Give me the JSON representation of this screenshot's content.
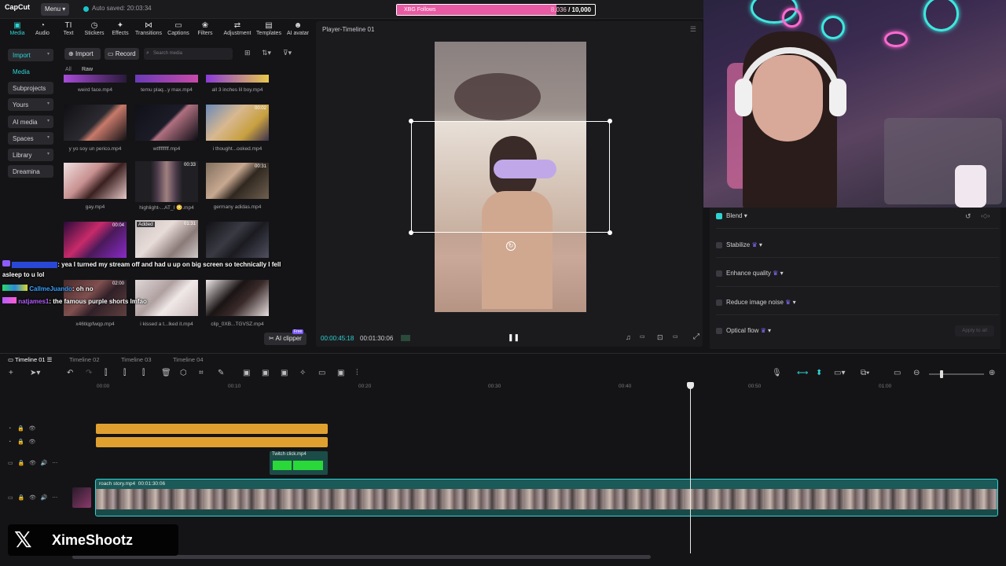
{
  "app": {
    "logo": "CapCut",
    "menu_label": "Menu",
    "autosave": "Auto saved: 20:03:34"
  },
  "follow_goal": {
    "label": "XBG Follows",
    "current": "8,036",
    "separator": " / ",
    "goal": "10,000",
    "progress": 0.8036
  },
  "tabs": [
    {
      "label": "Media",
      "icon": "media-icon",
      "active": true
    },
    {
      "label": "Audio",
      "icon": "audio-icon"
    },
    {
      "label": "Text",
      "icon": "text-icon"
    },
    {
      "label": "Stickers",
      "icon": "stickers-icon"
    },
    {
      "label": "Effects",
      "icon": "effects-icon"
    },
    {
      "label": "Transitions",
      "icon": "transitions-icon"
    },
    {
      "label": "Captions",
      "icon": "captions-icon"
    },
    {
      "label": "Filters",
      "icon": "filters-icon"
    },
    {
      "label": "Adjustment",
      "icon": "adjustment-icon"
    },
    {
      "label": "Templates",
      "icon": "templates-icon"
    },
    {
      "label": "AI avatar",
      "icon": "ai-avatar-icon"
    }
  ],
  "sidenav": [
    "Import",
    "Media",
    "Subprojects",
    "Yours",
    "AI media",
    "Spaces",
    "Library",
    "Dreamina"
  ],
  "media": {
    "import_label": "Import",
    "record_label": "Record",
    "search_placeholder": "Search media",
    "filter_all": "All",
    "filter_raw": "Raw",
    "items": [
      {
        "name": "weird face.mp4",
        "duration": ""
      },
      {
        "name": "temu plaq...y max.mp4",
        "duration": ""
      },
      {
        "name": "all 3 inches lil boy.mp4",
        "duration": ""
      },
      {
        "name": "y yo soy un perico.mp4",
        "duration": ""
      },
      {
        "name": "wtffffffff.mp4",
        "duration": ""
      },
      {
        "name": "i thought...ooked.mp4",
        "duration": "00:02"
      },
      {
        "name": "gay.mp4",
        "duration": ""
      },
      {
        "name": "highlight-...AT_I 😳.mp4",
        "duration": "00:33"
      },
      {
        "name": "germany adidas.mp4",
        "duration": "00:31"
      },
      {
        "name": "",
        "duration": "00:04"
      },
      {
        "name": "",
        "duration": "01:31",
        "badge": "Added"
      },
      {
        "name": "",
        "duration": ""
      },
      {
        "name": "x46tlqpfwqp.mp4",
        "duration": "02:00"
      },
      {
        "name": "i kissed a t...lked it.mp4",
        "duration": ""
      },
      {
        "name": "clip_0XB...TGVSZ.mp4",
        "duration": ""
      }
    ],
    "ai_clipper": "AI clipper",
    "free_badge": "Free"
  },
  "chat": [
    {
      "user": "",
      "text": ": yea I turned my stream off and had u up on big screen so technically I fell asleep to u lol",
      "user_color": "#4a6cff"
    },
    {
      "user": "CallmeJuando",
      "text": ": oh no",
      "user_color": "#3aa0ff"
    },
    {
      "user": "natjames1",
      "text": ": the famous purple shorts lmfao",
      "user_color": "#b45cff"
    }
  ],
  "player": {
    "title": "Player-Timeline 01",
    "current_time": "00:00:45:18",
    "total_time": "00:01:30:06"
  },
  "properties": [
    {
      "label": "Blend",
      "checked": true
    },
    {
      "label": "Stabilize",
      "checked": false
    },
    {
      "label": "Enhance quality",
      "checked": false
    },
    {
      "label": "Reduce image noise",
      "checked": false
    },
    {
      "label": "Optical flow",
      "checked": false
    }
  ],
  "apply_all": "Apply to all",
  "timeline": {
    "tabs": [
      "Timeline 01",
      "Timeline 02",
      "Timeline 03",
      "Timeline 04"
    ],
    "ticks": [
      "00:00",
      "00:10",
      "00:20",
      "00:30",
      "00:40",
      "00:50",
      "01:00"
    ],
    "twitch_clip": "Twitch click.mp4",
    "main_clip": "roach story.mp4",
    "main_clip_duration": "00:01:30:06"
  },
  "watermark": {
    "x": "𝕏",
    "name": "XimeShootz"
  },
  "colors": {
    "accent": "#2ed4d4",
    "follow_fill": "#e85aa3",
    "orange_clip": "#e0a030"
  }
}
